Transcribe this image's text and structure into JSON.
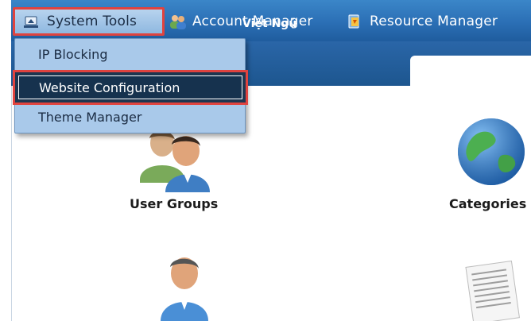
{
  "menu": {
    "system_tools": "System Tools",
    "account_manager": "Account Manager",
    "resource_manager": "Resource Manager"
  },
  "dropdown": {
    "items": [
      "IP Blocking",
      "Website Configuration",
      "Theme Manager"
    ],
    "selected": "Website Configuration"
  },
  "language_tab": "Việt Ngữ",
  "tiles": {
    "user_groups": "User Groups",
    "categories": "Categories"
  },
  "colors": {
    "nav_blue": "#2b6fb5",
    "highlight_red": "#e0433f",
    "menu_bg": "#a9c9ea",
    "selected_bg": "#16324e"
  }
}
